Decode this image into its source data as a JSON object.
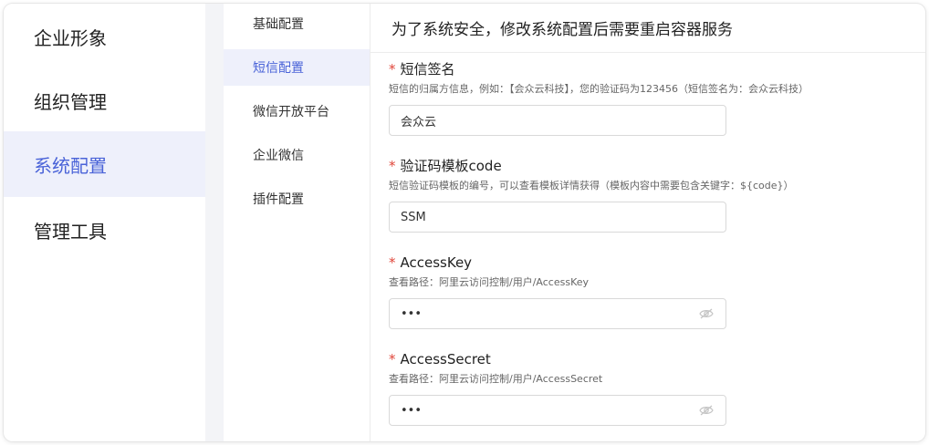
{
  "nav": {
    "items": [
      {
        "label": "企业形象"
      },
      {
        "label": "组织管理"
      },
      {
        "label": "系统配置"
      },
      {
        "label": "管理工具"
      }
    ]
  },
  "subnav": {
    "items": [
      {
        "label": "基础配置"
      },
      {
        "label": "短信配置"
      },
      {
        "label": "微信开放平台"
      },
      {
        "label": "企业微信"
      },
      {
        "label": "插件配置"
      }
    ]
  },
  "main": {
    "header": "为了系统安全，修改系统配置后需要重启容器服务",
    "fields": [
      {
        "required_mark": "*",
        "label": "短信签名",
        "hint": "短信的归属方信息，例如：【会众云科技】，您的验证码为123456（短信签名为：会众云科技）",
        "value": "会众云"
      },
      {
        "required_mark": "*",
        "label": "验证码模板code",
        "hint": "短信验证码模板的编号，可以查看模板详情获得（模板内容中需要包含关键字：${code}）",
        "value": "SSM"
      },
      {
        "required_mark": "*",
        "label": "AccessKey",
        "hint": "查看路径：阿里云访问控制/用户/AccessKey",
        "value": "•••"
      },
      {
        "required_mark": "*",
        "label": "AccessSecret",
        "hint": "查看路径：阿里云访问控制/用户/AccessSecret",
        "value": "•••"
      }
    ]
  },
  "icons": {
    "password_toggle": "eye-icon"
  },
  "colors": {
    "accent": "#4a63d8",
    "active_bg": "#eef0fb",
    "required": "#e0463a"
  }
}
